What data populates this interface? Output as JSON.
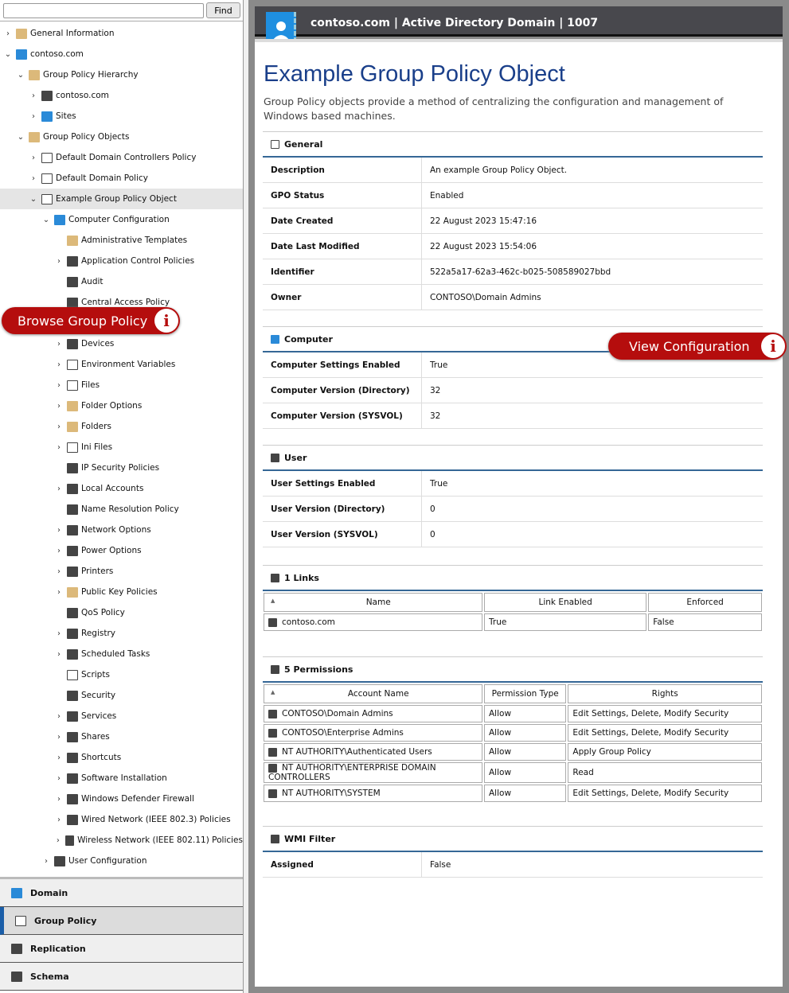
{
  "search": {
    "value": "",
    "find_label": "Find"
  },
  "tree": [
    {
      "label": "General Information",
      "level": 0,
      "chev": "right",
      "icon": "folder-icon"
    },
    {
      "label": "contoso.com",
      "level": 0,
      "chev": "down",
      "icon": "domain-icon"
    },
    {
      "label": "Group Policy Hierarchy",
      "level": 1,
      "chev": "down",
      "icon": "folder-icon"
    },
    {
      "label": "contoso.com",
      "level": 2,
      "chev": "right",
      "icon": "server-icon"
    },
    {
      "label": "Sites",
      "level": 2,
      "chev": "right",
      "icon": "sites-icon"
    },
    {
      "label": "Group Policy Objects",
      "level": 1,
      "chev": "down",
      "icon": "gpo-folder-icon"
    },
    {
      "label": "Default Domain Controllers Policy",
      "level": 2,
      "chev": "right",
      "icon": "policy-icon"
    },
    {
      "label": "Default Domain Policy",
      "level": 2,
      "chev": "right",
      "icon": "policy-icon"
    },
    {
      "label": "Example Group Policy Object",
      "level": 2,
      "chev": "down",
      "icon": "policy-icon",
      "selected": true
    },
    {
      "label": "Computer Configuration",
      "level": 3,
      "chev": "down",
      "icon": "computer-icon"
    },
    {
      "label": "Administrative Templates",
      "level": 4,
      "chev": "",
      "icon": "folder-icon"
    },
    {
      "label": "Application Control Policies",
      "level": 4,
      "chev": "right",
      "icon": "app-control-icon"
    },
    {
      "label": "Audit",
      "level": 4,
      "chev": "",
      "icon": "audit-icon"
    },
    {
      "label": "Central Access Policy",
      "level": 4,
      "chev": "",
      "icon": "shield-icon"
    },
    {
      "label": "",
      "level": 4,
      "chev": "",
      "icon": ""
    },
    {
      "label": "Devices",
      "level": 4,
      "chev": "right",
      "icon": "devices-icon"
    },
    {
      "label": "Environment Variables",
      "level": 4,
      "chev": "right",
      "icon": "list-icon"
    },
    {
      "label": "Files",
      "level": 4,
      "chev": "right",
      "icon": "file-icon"
    },
    {
      "label": "Folder Options",
      "level": 4,
      "chev": "right",
      "icon": "folder-options-icon"
    },
    {
      "label": "Folders",
      "level": 4,
      "chev": "right",
      "icon": "folder-icon"
    },
    {
      "label": "Ini Files",
      "level": 4,
      "chev": "right",
      "icon": "ini-file-icon"
    },
    {
      "label": "IP Security Policies",
      "level": 4,
      "chev": "",
      "icon": "ip-security-icon"
    },
    {
      "label": "Local Accounts",
      "level": 4,
      "chev": "right",
      "icon": "users-icon"
    },
    {
      "label": "Name Resolution Policy",
      "level": 4,
      "chev": "",
      "icon": "server-icon"
    },
    {
      "label": "Network Options",
      "level": 4,
      "chev": "right",
      "icon": "network-icon"
    },
    {
      "label": "Power Options",
      "level": 4,
      "chev": "right",
      "icon": "power-icon"
    },
    {
      "label": "Printers",
      "level": 4,
      "chev": "right",
      "icon": "printer-icon"
    },
    {
      "label": "Public Key Policies",
      "level": 4,
      "chev": "right",
      "icon": "folder-icon"
    },
    {
      "label": "QoS Policy",
      "level": 4,
      "chev": "",
      "icon": "qos-icon"
    },
    {
      "label": "Registry",
      "level": 4,
      "chev": "right",
      "icon": "registry-icon"
    },
    {
      "label": "Scheduled Tasks",
      "level": 4,
      "chev": "right",
      "icon": "clock-icon"
    },
    {
      "label": "Scripts",
      "level": 4,
      "chev": "",
      "icon": "script-icon"
    },
    {
      "label": "Security",
      "level": 4,
      "chev": "",
      "icon": "lock-icon"
    },
    {
      "label": "Services",
      "level": 4,
      "chev": "right",
      "icon": "services-icon"
    },
    {
      "label": "Shares",
      "level": 4,
      "chev": "right",
      "icon": "share-icon"
    },
    {
      "label": "Shortcuts",
      "level": 4,
      "chev": "right",
      "icon": "shortcut-icon"
    },
    {
      "label": "Software Installation",
      "level": 4,
      "chev": "right",
      "icon": "software-icon"
    },
    {
      "label": "Windows Defender Firewall",
      "level": 4,
      "chev": "right",
      "icon": "firewall-icon"
    },
    {
      "label": "Wired Network (IEEE 802.3) Policies",
      "level": 4,
      "chev": "right",
      "icon": "wired-network-icon"
    },
    {
      "label": "Wireless Network (IEEE 802.11) Policies",
      "level": 4,
      "chev": "right",
      "icon": "wifi-icon"
    },
    {
      "label": "User Configuration",
      "level": 3,
      "chev": "right",
      "icon": "user-icon"
    }
  ],
  "nav": [
    {
      "label": "Domain",
      "icon": "domain-icon"
    },
    {
      "label": "Group Policy",
      "icon": "policy-icon",
      "active": true
    },
    {
      "label": "Replication",
      "icon": "replication-icon"
    },
    {
      "label": "Schema",
      "icon": "schema-icon"
    }
  ],
  "callouts": {
    "browse": "Browse Group Policy",
    "view": "View Configuration",
    "info": "i"
  },
  "header": {
    "title": "contoso.com | Active Directory Domain | 1007"
  },
  "page": {
    "title": "Example Group Policy Object",
    "description": "Group Policy objects provide a method of centralizing the configuration and management of Windows based machines."
  },
  "sections": {
    "general": {
      "title": "General",
      "rows": [
        [
          "Description",
          "An example Group Policy Object."
        ],
        [
          "GPO Status",
          "Enabled"
        ],
        [
          "Date Created",
          "22 August 2023 15:47:16"
        ],
        [
          "Date Last Modified",
          "22 August 2023 15:54:06"
        ],
        [
          "Identifier",
          "522a5a17-62a3-462c-b025-508589027bbd"
        ],
        [
          "Owner",
          "CONTOSO\\Domain Admins"
        ]
      ]
    },
    "computer": {
      "title": "Computer",
      "rows": [
        [
          "Computer Settings Enabled",
          "True"
        ],
        [
          "Computer Version (Directory)",
          "32"
        ],
        [
          "Computer Version (SYSVOL)",
          "32"
        ]
      ]
    },
    "user": {
      "title": "User",
      "rows": [
        [
          "User Settings Enabled",
          "True"
        ],
        [
          "User Version (Directory)",
          "0"
        ],
        [
          "User Version (SYSVOL)",
          "0"
        ]
      ]
    },
    "links": {
      "title": "1 Links",
      "columns": [
        "Name",
        "Link Enabled",
        "Enforced"
      ],
      "rows": [
        [
          "contoso.com",
          "True",
          "False"
        ]
      ]
    },
    "permissions": {
      "title": "5 Permissions",
      "columns": [
        "Account Name",
        "Permission Type",
        "Rights"
      ],
      "rows": [
        [
          "CONTOSO\\Domain Admins",
          "Allow",
          "Edit Settings, Delete, Modify Security"
        ],
        [
          "CONTOSO\\Enterprise Admins",
          "Allow",
          "Edit Settings, Delete, Modify Security"
        ],
        [
          "NT AUTHORITY\\Authenticated Users",
          "Allow",
          "Apply Group Policy"
        ],
        [
          "NT AUTHORITY\\ENTERPRISE DOMAIN CONTROLLERS",
          "Allow",
          "Read"
        ],
        [
          "NT AUTHORITY\\SYSTEM",
          "Allow",
          "Edit Settings, Delete, Modify Security"
        ]
      ]
    },
    "wmi": {
      "title": "WMI Filter",
      "rows": [
        [
          "Assigned",
          "False"
        ]
      ]
    }
  },
  "colors": {
    "accent": "#356796",
    "title": "#1a3f8a",
    "callout": "#b50d0d",
    "header": "#48484d"
  }
}
